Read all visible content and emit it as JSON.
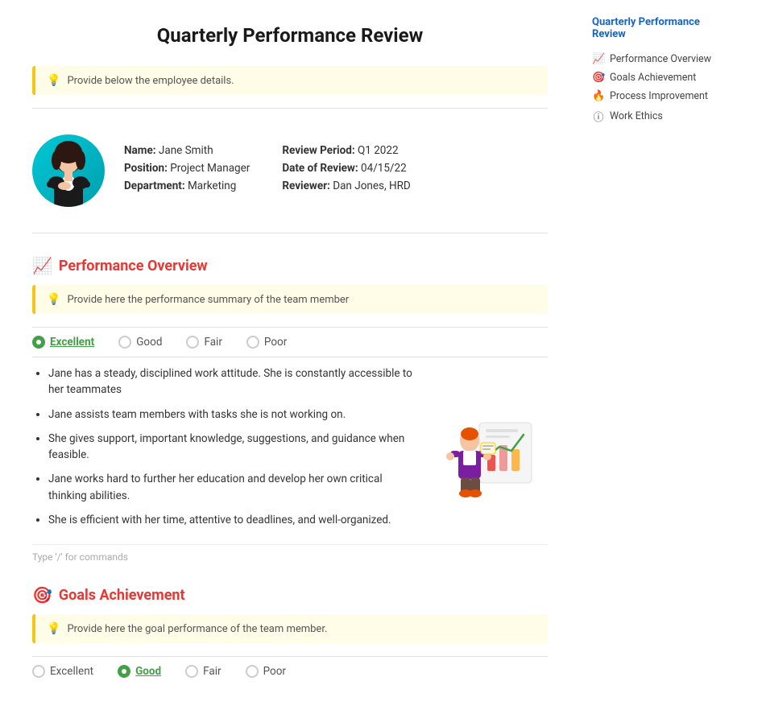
{
  "page": {
    "title": "Quarterly Performance Review"
  },
  "hint1": {
    "text": "Provide below the employee details."
  },
  "employee": {
    "name_label": "Name:",
    "name_value": "Jane Smith",
    "position_label": "Position:",
    "position_value": "Project Manager",
    "department_label": "Department:",
    "department_value": "Marketing",
    "review_period_label": "Review Period:",
    "review_period_value": "Q1 2022",
    "date_label": "Date of Review:",
    "date_value": "04/15/22",
    "reviewer_label": "Reviewer:",
    "reviewer_value": "Dan Jones, HRD"
  },
  "performance_section": {
    "icon": "📈",
    "title": "Performance Overview",
    "hint": "Provide here the performance summary of the team member",
    "ratings": [
      {
        "label": "Excellent",
        "selected": true
      },
      {
        "label": "Good",
        "selected": false
      },
      {
        "label": "Fair",
        "selected": false
      },
      {
        "label": "Poor",
        "selected": false
      }
    ],
    "bullets": [
      "Jane has a steady, disciplined work attitude. She is constantly accessible to her teammates",
      "Jane assists team members with tasks she is not working on.",
      "She gives support, important knowledge, suggestions, and guidance when feasible.",
      "Jane works hard to further her education and develop her own critical thinking abilities.",
      "She is efficient with her time, attentive to deadlines, and well-organized."
    ],
    "slash_hint": "Type '/' for commands"
  },
  "goals_section": {
    "icon": "🎯",
    "title": "Goals Achievement",
    "hint": "Provide here the goal performance of the team member.",
    "ratings": [
      {
        "label": "Excellent",
        "selected": false
      },
      {
        "label": "Good",
        "selected": true
      },
      {
        "label": "Fair",
        "selected": false
      },
      {
        "label": "Poor",
        "selected": false
      }
    ]
  },
  "sidebar": {
    "title": "Quarterly Performance Review",
    "items": [
      {
        "icon": "📈",
        "label": "Performance Overview",
        "active": false
      },
      {
        "icon": "🎯",
        "label": "Goals Achievement",
        "active": false
      },
      {
        "icon": "🔥",
        "label": "Process Improvement",
        "active": false
      },
      {
        "icon": "ⓘ",
        "label": "Work Ethics",
        "active": false
      }
    ]
  }
}
